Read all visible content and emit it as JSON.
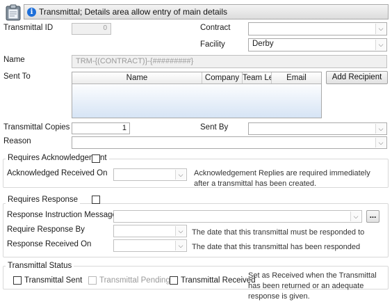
{
  "header": {
    "icon": "transmittal-clipboard-icon",
    "info_icon": "i",
    "title": "Transmittal; Details area allow entry of main details"
  },
  "fields": {
    "transmittal_id_label": "Transmittal ID",
    "transmittal_id_value": "0",
    "contract_label": "Contract",
    "contract_value": "",
    "facility_label": "Facility",
    "facility_value": "Derby",
    "name_label": "Name",
    "name_value": "TRM-{(CONTRACT)}-{#########}",
    "sent_to_label": "Sent To",
    "transmittal_copies_label": "Transmittal Copies",
    "transmittal_copies_value": "1",
    "sent_by_label": "Sent By",
    "sent_by_value": "",
    "reason_label": "Reason",
    "reason_value": ""
  },
  "recipients": {
    "columns": [
      "Name",
      "Company",
      "Team Le",
      "Email"
    ],
    "rows": [],
    "add_button": "Add Recipient"
  },
  "acknowledgement": {
    "title": "Requires Acknowledgement",
    "checked": false,
    "received_on_label": "Acknowledged Received On",
    "received_on_value": "",
    "hint": "Acknowledgement Replies are required immediately after a transmittal has been created."
  },
  "response": {
    "title": "Requires Response",
    "checked": false,
    "instruction_label": "Response Instruction Message",
    "instruction_value": "",
    "browse_button": "...",
    "require_by_label": "Require Response By",
    "require_by_value": "",
    "require_by_hint": "The date that this transmittal must be responded to",
    "received_on_label": "Response Received On",
    "received_on_value": "",
    "received_on_hint": "The date that this transmittal has been responded"
  },
  "status": {
    "title": "Transmittal Status",
    "sent_label": "Transmittal Sent",
    "sent_checked": false,
    "pending_label": "Transmittal Pending",
    "pending_checked": false,
    "pending_disabled": true,
    "received_label": "Transmittal Received",
    "received_checked": false,
    "hint": "Set as Received when the Transmittal has been returned or an adequate response is given."
  },
  "colors": {
    "grid_gradient_bottom": "#d6e4f5",
    "info_blue": "#1e6fd9"
  }
}
